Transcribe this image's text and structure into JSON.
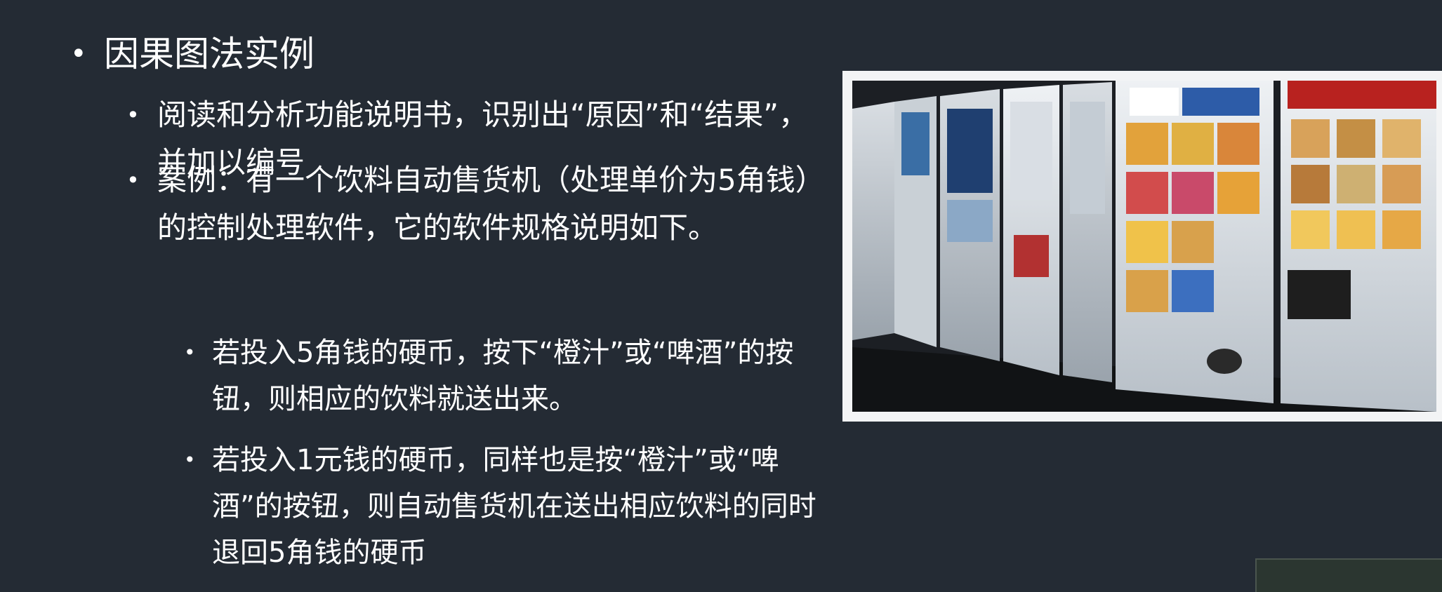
{
  "slide": {
    "title": "因果图法实例",
    "points": [
      "阅读和分析功能说明书，识别出“原因”和“结果”，并加以编号",
      "案例：有一个饮料自动售货机（处理单价为5角钱）的控制处理软件，它的软件规格说明如下。"
    ],
    "subpoints": [
      "若投入5角钱的硬币，按下“橙汁”或“啤酒”的按钮，则相应的饮料就送出来。",
      "若投入1元钱的硬币，同样也是按“橙汁”或“啤酒”的按钮，则自动售货机在送出相应饮料的同时退回5角钱的硬币"
    ]
  },
  "colors": {
    "background": "#242b34",
    "text": "#ffffff",
    "frame": "#f3f4f5"
  },
  "image": {
    "icon": "vending-machines-photo"
  }
}
